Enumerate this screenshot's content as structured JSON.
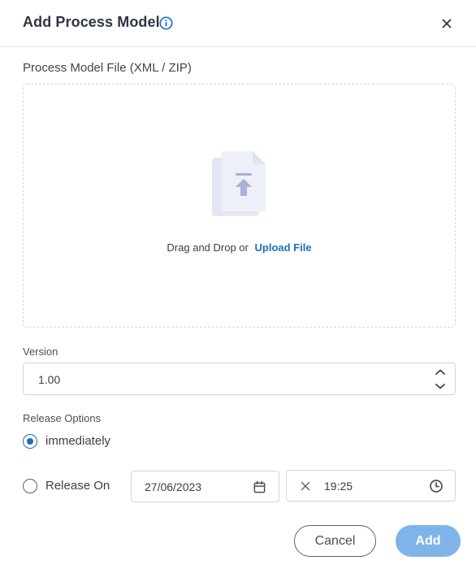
{
  "dialog": {
    "title": "Add Process Model",
    "info_icon": "info-circle-icon",
    "close_icon": "close-icon"
  },
  "file_upload": {
    "label": "Process Model File (XML / ZIP)",
    "icon": "file-upload-icon",
    "drop_text": "Drag and Drop or",
    "upload_link": "Upload File"
  },
  "version": {
    "label": "Version",
    "value": "1.00",
    "increment_icon": "chevron-up-icon",
    "decrement_icon": "chevron-down-icon"
  },
  "release_options": {
    "label": "Release Options",
    "options": [
      {
        "label": "immediately",
        "selected": true
      },
      {
        "label": "Release On",
        "selected": false
      }
    ],
    "date_value": "27/06/2023",
    "date_icon": "calendar-icon",
    "time_value": "19:25",
    "time_clear_icon": "clear-icon",
    "time_icon": "clock-icon"
  },
  "footer": {
    "cancel_label": "Cancel",
    "add_label": "Add"
  },
  "colors": {
    "accent": "#1c6fbf",
    "add_button_disabled": "#7eb4e8",
    "border": "#d3d6dc"
  }
}
